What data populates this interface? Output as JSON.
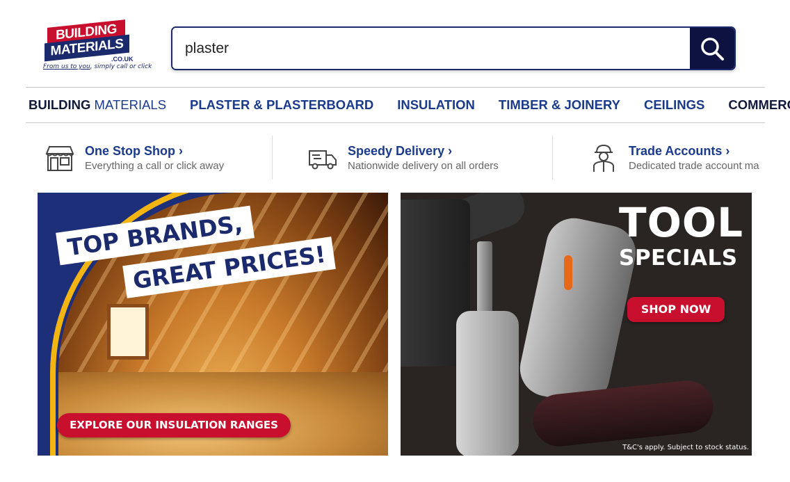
{
  "logo": {
    "line1": "BUILDING",
    "line2": "MATERIALS",
    "domain": ".CO.UK",
    "tagline_a": "From us to you",
    "tagline_b": "simply call or click"
  },
  "search": {
    "value": "plaster",
    "button_icon": "search-icon"
  },
  "nav": {
    "items": [
      {
        "label_bold": "BUILDING",
        "label_rest": " MATERIALS"
      },
      {
        "label": "PLASTER & PLASTERBOARD"
      },
      {
        "label": "INSULATION"
      },
      {
        "label": "TIMBER & JOINERY"
      },
      {
        "label": "CEILINGS"
      },
      {
        "label": "COMMERCIAL"
      }
    ]
  },
  "usp": [
    {
      "title": "One Stop Shop",
      "chevron": "›",
      "subtitle": "Everything a call or click away",
      "icon": "shop-icon"
    },
    {
      "title": "Speedy Delivery",
      "chevron": "›",
      "subtitle": "Nationwide delivery on all orders",
      "icon": "truck-icon"
    },
    {
      "title": "Trade Accounts",
      "chevron": "›",
      "subtitle": "Dedicated trade account ma",
      "icon": "worker-icon"
    }
  ],
  "banners": {
    "left": {
      "headline_1": "TOP BRANDS,",
      "headline_2": "GREAT PRICES!",
      "cta": "EXPLORE OUR INSULATION RANGES"
    },
    "right": {
      "title": "TOOL",
      "subtitle": "SPECIALS",
      "cta": "SHOP NOW",
      "terms": "T&C's apply. Subject to stock status."
    }
  },
  "colors": {
    "brand_navy": "#1a2a6c",
    "brand_red": "#c8102e",
    "link_blue": "#1a3a8c",
    "search_button": "#0d1240"
  }
}
